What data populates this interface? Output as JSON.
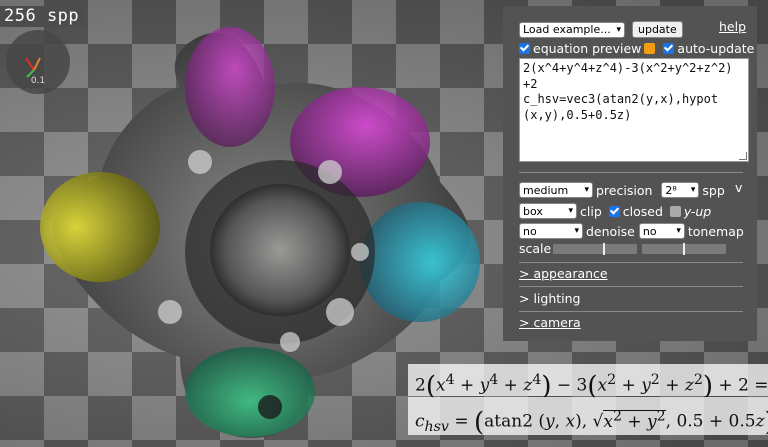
{
  "viewport": {
    "spp_counter": "256 spp",
    "gizmo_value": "0.1"
  },
  "panel": {
    "load_example": "Load example...",
    "update": "update",
    "help": "help",
    "equation_preview": "equation preview",
    "equation_preview_checked": true,
    "auto_update": "auto-update",
    "auto_update_checked": true,
    "equation_text": "2(x^4+y^4+z^4)-3(x^2+y^2+z^2)\n+2\nc_hsv=vec3(atan2(y,x),hypot\n(x,y),0.5+0.5z)",
    "precision_value": "medium",
    "precision_label": "precision",
    "spp_value": "2⁸",
    "spp_label": "spp",
    "collapse": "v",
    "clip_value": "box",
    "clip_label": "clip",
    "closed_label": "closed",
    "closed_checked": true,
    "yup_label": "y-up",
    "yup_checked": false,
    "denoise_value": "no",
    "denoise_label": "denoise",
    "tonemap_value": "no",
    "tonemap_label": "tonemap",
    "scale_label": "scale",
    "scale_left_level": 0.6,
    "scale_right_level": 0.5,
    "appearance": "> appearance",
    "lighting": "> lighting",
    "camera": "> camera"
  },
  "colors": {
    "panel_bg": "#535353",
    "checkbox_blue": "#1a73e8",
    "checkbox_orange": "#f39c12"
  }
}
